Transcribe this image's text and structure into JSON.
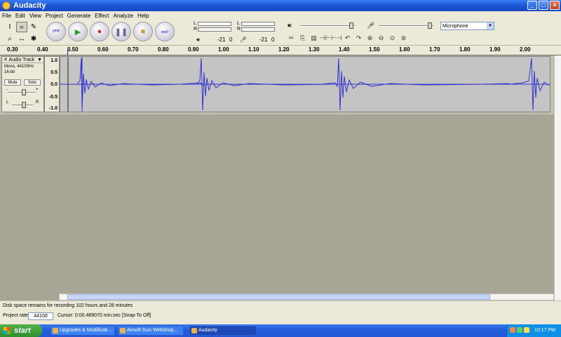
{
  "window": {
    "title": "Audacity"
  },
  "menu": [
    "File",
    "Edit",
    "View",
    "Project",
    "Generate",
    "Effect",
    "Analyze",
    "Help"
  ],
  "meters": {
    "output": {
      "l": "L",
      "r": "R",
      "db": "-21",
      "zero": "0"
    },
    "input": {
      "l": "L",
      "r": "R",
      "db": "-21",
      "zero": "0"
    }
  },
  "input_source": "Microphone",
  "ruler_ticks": [
    "0.30",
    "0.40",
    "0.50",
    "0.60",
    "0.70",
    "0.80",
    "0.90",
    "1.00",
    "1.10",
    "1.20",
    "1.30",
    "1.40",
    "1.50",
    "1.60",
    "1.70",
    "1.80",
    "1.90",
    "2.00"
  ],
  "track": {
    "name": "Audio Track",
    "rate": "Mono, 44100Hz",
    "bits": "16-bit",
    "mute": "Mute",
    "solo": "Solo",
    "gain_minus": "-",
    "gain_plus": "+",
    "pan_l": "L",
    "pan_r": "R",
    "scale": [
      "1.0",
      "0.5",
      "0.0",
      "-0.5",
      "-1.0"
    ]
  },
  "status": {
    "disk": "Disk space remains for recording 102 hours and 28 minutes",
    "project_rate_label": "Project rate:",
    "project_rate": "44100",
    "cursor": "Cursor: 0:00.489070 min:sec",
    "snap": "[Snap-To Off]"
  },
  "taskbar": {
    "start": "start",
    "tasks": [
      "Upgrades & Modificati...",
      "Airsoft Gun Webshop...",
      "Audacity"
    ],
    "clock": "10:17 PM"
  }
}
